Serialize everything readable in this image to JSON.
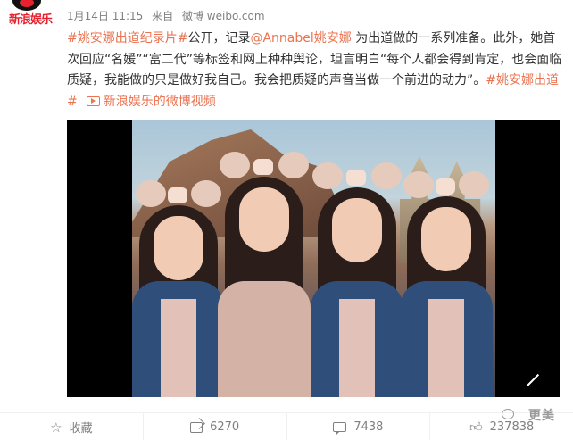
{
  "account": {
    "avatar_text": "新浪娱乐"
  },
  "post": {
    "date": "1月14日 11:15",
    "source_prefix": "来自",
    "source": "微博 weibo.com",
    "text": {
      "tag1": "#姚安娜出道纪录片#",
      "part1": "公开，记录",
      "mention": "@Annabel姚安娜",
      "part2": " 为出道做的一系列准备。此外，她首次回应“名媛”“富二代”等标签和网上种种舆论，坦言明白“每个人都会得到肯定，也会面临质疑，我能做的只是做好我自己。我会把质疑的声音当做一个前进的动力”。",
      "tag2": "#姚安娜出道#",
      "video_link": "新浪娱乐的微博视频"
    }
  },
  "video": {
    "expand_icon": "expand-icon"
  },
  "actions": {
    "favorite_label": "收藏",
    "share_count": "6270",
    "comment_count": "7438",
    "like_count": "237838"
  },
  "watermark": {
    "text": "更美"
  },
  "colors": {
    "link": "#eb7350",
    "meta": "#808080"
  }
}
